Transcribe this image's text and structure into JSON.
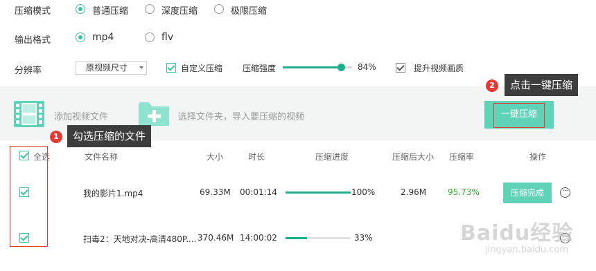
{
  "settings": {
    "mode": {
      "label": "压缩模式",
      "options": [
        "普通压缩",
        "深度压缩",
        "极限压缩"
      ],
      "selected": 0
    },
    "format": {
      "label": "输出格式",
      "options": [
        "mp4",
        "flv"
      ],
      "selected": 0
    },
    "resolution": {
      "label": "分辨率",
      "value": "原视频尺寸"
    },
    "custom_compress": {
      "label": "自定义压缩",
      "checked": true
    },
    "strength": {
      "label": "压缩强度",
      "value": 84,
      "display": "84%"
    },
    "improve_quality": {
      "label": "提升视频画质",
      "checked": true
    }
  },
  "toolbar": {
    "add_video": "添加视频文件",
    "select_folder": "选择文件夹，导入要压缩的视频",
    "one_key": "一键压缩"
  },
  "annotations": {
    "tip1": {
      "badge": "1",
      "text": "勾选压缩的文件"
    },
    "tip2": {
      "badge": "2",
      "text": "点击一键压缩"
    }
  },
  "table": {
    "headers": {
      "select_all": "全选",
      "name": "文件名称",
      "size": "大小",
      "duration": "时长",
      "progress": "压缩进度",
      "size_after": "压缩后大小",
      "ratio": "压缩率",
      "action": "操作"
    },
    "rows": [
      {
        "checked": true,
        "name": "我的影片1.mp4",
        "size": "69.33M",
        "duration": "00:01:14",
        "progress": 100,
        "progress_text": "100%",
        "size_after": "2.96M",
        "ratio": "95.73%",
        "action": "压缩完成",
        "more": "···"
      },
      {
        "checked": true,
        "name": "扫毒2：天地对决-高清480P....",
        "size": "370.46M",
        "duration": "14:00:02",
        "progress": 33,
        "progress_text": "33%",
        "size_after": "",
        "ratio": "",
        "action": "",
        "more": "···"
      }
    ]
  },
  "watermark": {
    "brand": "Baidu经验",
    "url": "jingyan.baidu.com"
  },
  "colors": {
    "accent": "#1fae8b",
    "button": "#5fd3b8",
    "ratio_green": "#2eb82e",
    "annotation_red": "#e53935",
    "tip_bg": "#3d3d3d",
    "panel_bg": "#f3f4f4"
  }
}
